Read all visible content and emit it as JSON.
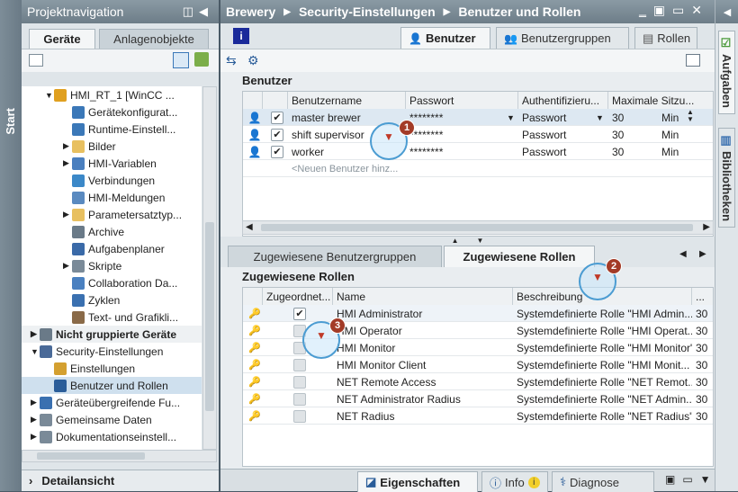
{
  "left": {
    "side_tab": "Start",
    "title": "Projektnavigation",
    "tabs": [
      {
        "label": "Geräte"
      },
      {
        "label": "Anlagenobjekte"
      }
    ],
    "tree": [
      {
        "label": "HMI_RT_1 [WinCC ...",
        "expand": "▼",
        "color": "#e0a020",
        "indent": 0
      },
      {
        "label": "Gerätekonfigurat...",
        "expand": "",
        "color": "#3b78b8",
        "indent": 1
      },
      {
        "label": "Runtime-Einstell...",
        "expand": "",
        "color": "#3b78b8",
        "indent": 1
      },
      {
        "label": "Bilder",
        "expand": "▶",
        "color": "#e8c060",
        "indent": 1
      },
      {
        "label": "HMI-Variablen",
        "expand": "▶",
        "color": "#4a7fbf",
        "indent": 1
      },
      {
        "label": "Verbindungen",
        "expand": "",
        "color": "#3b88c8",
        "indent": 1
      },
      {
        "label": "HMI-Meldungen",
        "expand": "",
        "color": "#5a8ac0",
        "indent": 1
      },
      {
        "label": "Parametersatztyp...",
        "expand": "▶",
        "color": "#e8c060",
        "indent": 1
      },
      {
        "label": "Archive",
        "expand": "",
        "color": "#6a7a88",
        "indent": 1
      },
      {
        "label": "Aufgabenplaner",
        "expand": "",
        "color": "#3a6aa8",
        "indent": 1
      },
      {
        "label": "Skripte",
        "expand": "▶",
        "color": "#7a8a98",
        "indent": 1
      },
      {
        "label": "Collaboration Da...",
        "expand": "",
        "color": "#4a80c0",
        "indent": 1
      },
      {
        "label": "Zyklen",
        "expand": "",
        "color": "#3a70b0",
        "indent": 1
      },
      {
        "label": "Text- und Grafikli...",
        "expand": "",
        "color": "#8a6a48",
        "indent": 1
      },
      {
        "label": "Nicht gruppierte Geräte",
        "expand": "▶",
        "color": "#6a7a88",
        "indent": -1,
        "bold": true
      },
      {
        "label": "Security-Einstellungen",
        "expand": "▼",
        "color": "#4a6a98",
        "indent": -1
      },
      {
        "label": "Einstellungen",
        "expand": "",
        "color": "#d4a030",
        "indent": 0
      },
      {
        "label": "Benutzer und Rollen",
        "expand": "",
        "color": "#2a5d99",
        "indent": 0,
        "selected": true
      },
      {
        "label": "Geräteübergreifende Fu...",
        "expand": "▶",
        "color": "#3a70b0",
        "indent": -1
      },
      {
        "label": "Gemeinsame Daten",
        "expand": "▶",
        "color": "#7a8a98",
        "indent": -1
      },
      {
        "label": "Dokumentationseinstell...",
        "expand": "▶",
        "color": "#7a8a98",
        "indent": -1
      }
    ],
    "detail": "Detailansicht"
  },
  "breadcrumb": [
    "Brewery",
    "Security-Einstellungen",
    "Benutzer und Rollen"
  ],
  "top_tabs": [
    {
      "label": "Benutzer"
    },
    {
      "label": "Benutzergruppen"
    },
    {
      "label": "Rollen"
    }
  ],
  "users": {
    "title": "Benutzer",
    "columns": [
      "Benutzername",
      "Passwort",
      "Authentifizieru...",
      "Maximale Sitzu..."
    ],
    "rows": [
      {
        "name": "master brewer",
        "password": "********",
        "auth": "Passwort",
        "max": "30",
        "unit": "Min"
      },
      {
        "name": "shift supervisor",
        "password": "********",
        "auth": "Passwort",
        "max": "30",
        "unit": "Min"
      },
      {
        "name": "worker",
        "password": "********",
        "auth": "Passwort",
        "max": "30",
        "unit": "Min"
      }
    ],
    "new_row": "<Neuen Benutzer hinz..."
  },
  "lower_tabs": [
    {
      "label": "Zugewiesene Benutzergruppen"
    },
    {
      "label": "Zugewiesene Rollen"
    }
  ],
  "roles": {
    "title": "Zugewiesene Rollen",
    "columns": [
      "Zugeordnet...",
      "Name",
      "Beschreibung",
      "..."
    ],
    "rows": [
      {
        "name": "HMI Administrator",
        "desc": "Systemdefinierte Rolle \"HMI Admin...",
        "num": "30",
        "checked": true
      },
      {
        "name": "HMI Operator",
        "desc": "Systemdefinierte Rolle \"HMI Operat...",
        "num": "30",
        "checked": false
      },
      {
        "name": "HMI Monitor",
        "desc": "Systemdefinierte Rolle \"HMI Monitor\"",
        "num": "30",
        "checked": false
      },
      {
        "name": "HMI Monitor Client",
        "desc": "Systemdefinierte Rolle \"HMI Monit...",
        "num": "30",
        "checked": false
      },
      {
        "name": "NET Remote Access",
        "desc": "Systemdefinierte Rolle \"NET Remot...",
        "num": "30",
        "checked": false
      },
      {
        "name": "NET Administrator Radius",
        "desc": "Systemdefinierte Rolle \"NET Admin...",
        "num": "30",
        "checked": false
      },
      {
        "name": "NET Radius",
        "desc": "Systemdefinierte Rolle \"NET Radius\"",
        "num": "30",
        "checked": false
      }
    ]
  },
  "bottom_tabs": [
    {
      "label": "Eigenschaften"
    },
    {
      "label": "Info"
    },
    {
      "label": "Diagnose"
    }
  ],
  "right_tabs": [
    {
      "label": "Aufgaben"
    },
    {
      "label": "Bibliotheken"
    }
  ],
  "callouts": [
    "1",
    "2",
    "3"
  ]
}
